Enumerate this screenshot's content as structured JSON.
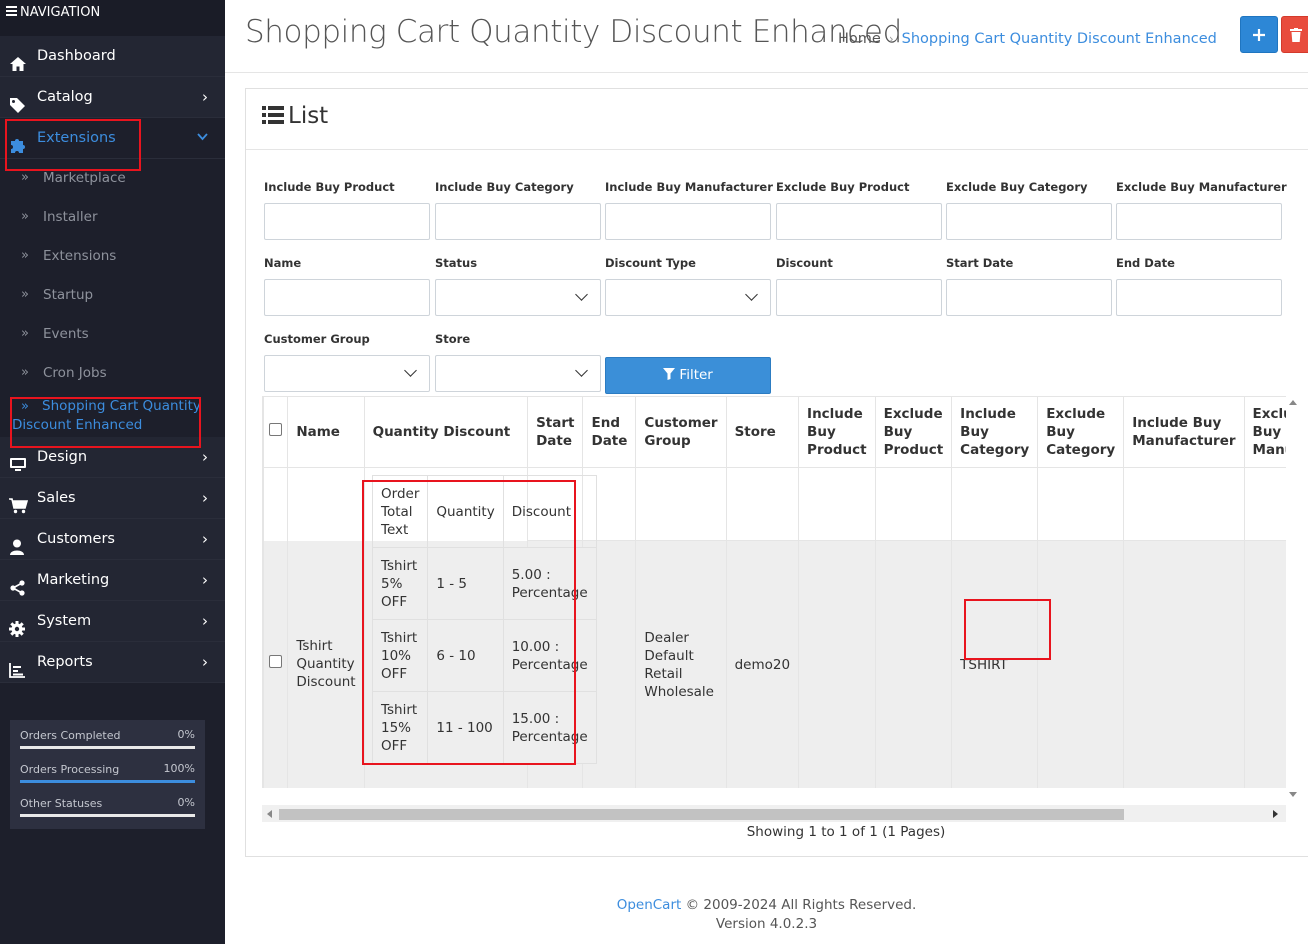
{
  "sidebar": {
    "title": "NAVIGATION",
    "menu": [
      {
        "label": "Dashboard"
      },
      {
        "label": "Catalog"
      },
      {
        "label": "Extensions"
      },
      {
        "label": "Design"
      },
      {
        "label": "Sales"
      },
      {
        "label": "Customers"
      },
      {
        "label": "Marketing"
      },
      {
        "label": "System"
      },
      {
        "label": "Reports"
      }
    ],
    "extensions_sub": [
      {
        "label": "Marketplace"
      },
      {
        "label": "Installer"
      },
      {
        "label": "Extensions"
      },
      {
        "label": "Startup"
      },
      {
        "label": "Events"
      },
      {
        "label": "Cron Jobs"
      },
      {
        "label": "Shopping Cart Quantity Discount Enhanced"
      }
    ],
    "stats": [
      {
        "label": "Orders Completed",
        "percent": "0%",
        "fill": 0
      },
      {
        "label": "Orders Processing",
        "percent": "100%",
        "fill": 100
      },
      {
        "label": "Other Statuses",
        "percent": "0%",
        "fill": 0
      }
    ]
  },
  "header": {
    "title": "Shopping Cart Quantity Discount Enhanced",
    "breadcrumb": {
      "home": "Home",
      "current": "Shopping Cart Quantity Discount Enhanced"
    },
    "add_icon": "plus-icon",
    "delete_icon": "trash-icon"
  },
  "card": {
    "title": "List",
    "filters": {
      "include_buy_product": "Include Buy Product",
      "include_buy_category": "Include Buy Category",
      "include_buy_manufacturer": "Include Buy Manufacturer",
      "exclude_buy_product": "Exclude Buy Product",
      "exclude_buy_category": "Exclude Buy Category",
      "exclude_buy_manufacturer": "Exclude Buy Manufacturer",
      "name": "Name",
      "status": "Status",
      "discount_type": "Discount Type",
      "discount": "Discount",
      "start_date": "Start Date",
      "end_date": "End Date",
      "customer_group": "Customer Group",
      "store": "Store"
    },
    "filter_button": "Filter",
    "table": {
      "headers": {
        "name": "Name",
        "quantity_discount": "Quantity Discount",
        "start_date": "Start Date",
        "end_date": "End Date",
        "customer_group": "Customer Group",
        "store": "Store",
        "include_buy_product": "Include Buy Product",
        "exclude_buy_product": "Exclude Buy Product",
        "include_buy_category": "Include Buy Category",
        "exclude_buy_category": "Exclude Buy Category",
        "include_buy_manufacturer": "Include Buy Manufacturer",
        "exclude_buy_manufacturer": "Exclude Buy Manufa"
      },
      "inner_headers": {
        "text": "Order Total Text",
        "quantity": "Quantity",
        "discount": "Discount"
      },
      "row": {
        "name": "Tshirt Quantity Discount",
        "tiers": [
          {
            "text": "Tshirt 5% OFF",
            "quantity": "1 - 5",
            "discount": "5.00 : Percentage"
          },
          {
            "text": "Tshirt 10% OFF",
            "quantity": "6 - 10",
            "discount": "10.00 : Percentage"
          },
          {
            "text": "Tshirt 15% OFF",
            "quantity": "11 - 100",
            "discount": "15.00 : Percentage"
          }
        ],
        "customer_group": "Dealer Default Retail Wholesale",
        "store": "demo20",
        "include_buy_category": "TSHIRT"
      }
    },
    "showing": "Showing 1 to 1 of 1 (1 Pages)"
  },
  "footer": {
    "brand": "OpenCart",
    "copyright": "© 2009-2024 All Rights Reserved.",
    "version": "Version 4.0.2.3"
  }
}
